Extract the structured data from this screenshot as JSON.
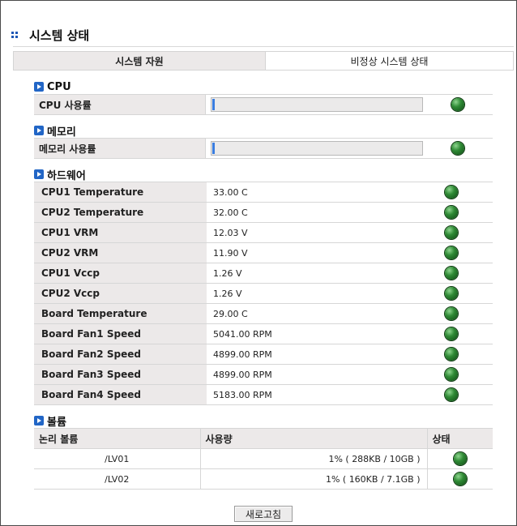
{
  "page": {
    "title": "시스템 상태"
  },
  "tabs": [
    {
      "label": "시스템 자원",
      "active": true
    },
    {
      "label": "비정상 시스템 상태",
      "active": false
    }
  ],
  "cpu": {
    "section_title": "CPU",
    "usage_label": "CPU 사용률",
    "usage_fraction": 0.01,
    "status": "ok"
  },
  "memory": {
    "section_title": "메모리",
    "usage_label": "메모리 사용률",
    "usage_fraction": 0.01,
    "status": "ok"
  },
  "hardware": {
    "section_title": "하드웨어",
    "rows": [
      {
        "name": "CPU1 Temperature",
        "value": "33.00 C",
        "status": "ok"
      },
      {
        "name": "CPU2 Temperature",
        "value": "32.00 C",
        "status": "ok"
      },
      {
        "name": "CPU1 VRM",
        "value": "12.03 V",
        "status": "ok"
      },
      {
        "name": "CPU2 VRM",
        "value": "11.90 V",
        "status": "ok"
      },
      {
        "name": "CPU1 Vccp",
        "value": "1.26 V",
        "status": "ok"
      },
      {
        "name": "CPU2 Vccp",
        "value": "1.26 V",
        "status": "ok"
      },
      {
        "name": "Board Temperature",
        "value": "29.00 C",
        "status": "ok"
      },
      {
        "name": "Board Fan1 Speed",
        "value": "5041.00 RPM",
        "status": "ok"
      },
      {
        "name": "Board Fan2 Speed",
        "value": "4899.00 RPM",
        "status": "ok"
      },
      {
        "name": "Board Fan3 Speed",
        "value": "4899.00 RPM",
        "status": "ok"
      },
      {
        "name": "Board Fan4 Speed",
        "value": "5183.00 RPM",
        "status": "ok"
      }
    ]
  },
  "volume": {
    "section_title": "볼륨",
    "headers": {
      "name": "논리 볼륨",
      "usage": "사용량",
      "status": "상태"
    },
    "rows": [
      {
        "name": "/LV01",
        "usage": "1% ( 288KB / 10GB )",
        "status": "ok"
      },
      {
        "name": "/LV02",
        "usage": "1% ( 160KB / 7.1GB )",
        "status": "ok"
      }
    ]
  },
  "refresh_button": {
    "label": "새로고침"
  },
  "colors": {
    "accent": "#2266c6",
    "status_ok": "#2f8a35",
    "label_bg": "#ece9e9"
  },
  "icons": {
    "title": "grid-dots-icon",
    "section": "arrow-square-icon",
    "status": "green-led-icon"
  }
}
